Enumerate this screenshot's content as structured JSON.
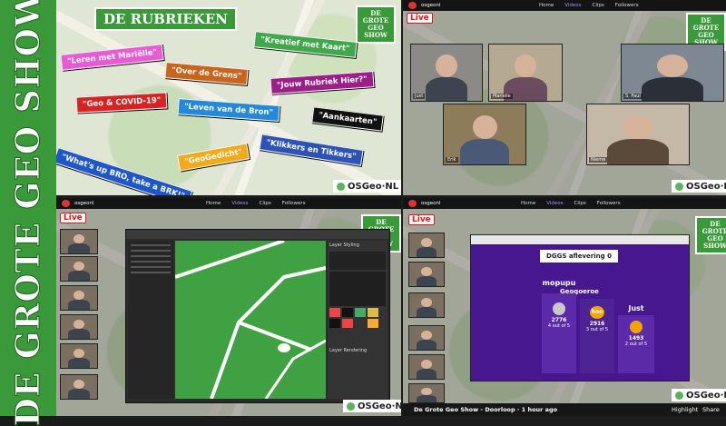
{
  "banner": {
    "title": "DE GROTE GEO SHOW"
  },
  "logo": {
    "line1": "DE",
    "line2": "GROTE",
    "line3": "GEO SHOW",
    "osgeo": "OSGeo·NL"
  },
  "live": "Live",
  "twitch": {
    "channel": "osgeonl",
    "tabs": [
      "Home",
      "Videos",
      "Clips",
      "Followers"
    ]
  },
  "rubrieken": {
    "title": "DE RUBRIEKEN",
    "tags": [
      {
        "label": "\"Leren met Mariëlle\"",
        "color": "#e85bd5"
      },
      {
        "label": "\"Over de Grens\"",
        "color": "#c8641b"
      },
      {
        "label": "\"Kreatief met Kaart\"",
        "color": "#3fa84a"
      },
      {
        "label": "\"Jouw Rubriek Hier?\"",
        "color": "#9b1f86"
      },
      {
        "label": "\"Geo & COVID-19\"",
        "color": "#d92323"
      },
      {
        "label": "\"Leven van de Bron\"",
        "color": "#2489d8"
      },
      {
        "label": "\"Aankaarten\"",
        "color": "#111111"
      },
      {
        "label": "\"What's up BRO, take a BRK!\"",
        "color": "#1f56c8"
      },
      {
        "label": "\"GeoGedicht\"",
        "color": "#f2a91a"
      },
      {
        "label": "\"Klikkers en Tikkers\"",
        "color": "#2d52b8"
      }
    ]
  },
  "call_names": [
    "Just",
    "Marielle",
    "S. Paul",
    "Erik",
    "Nieme"
  ],
  "kahoot": {
    "question": "DGGS aflevering 0",
    "leader": "Geogoeroe",
    "podium": [
      {
        "name": "mopupu",
        "score": "2776",
        "correct": "4 out of 5"
      },
      {
        "name": "hoo",
        "score": "2916",
        "correct": "3 out of 5"
      },
      {
        "name": "Just",
        "score": "1493",
        "correct": "2 out of 5"
      }
    ]
  },
  "qgis": {
    "panel": "Layer Styling",
    "rendering": "Layer Rendering"
  },
  "stream_footer": {
    "title": "De Grote Geo Show - Doorloop",
    "age": "1 hour ago",
    "highlight": "Highlight",
    "share": "Share"
  },
  "colors": {
    "green": "#3a9a3a",
    "kahoot_purple": "#46178f",
    "qgis_green": "#3fa141"
  }
}
